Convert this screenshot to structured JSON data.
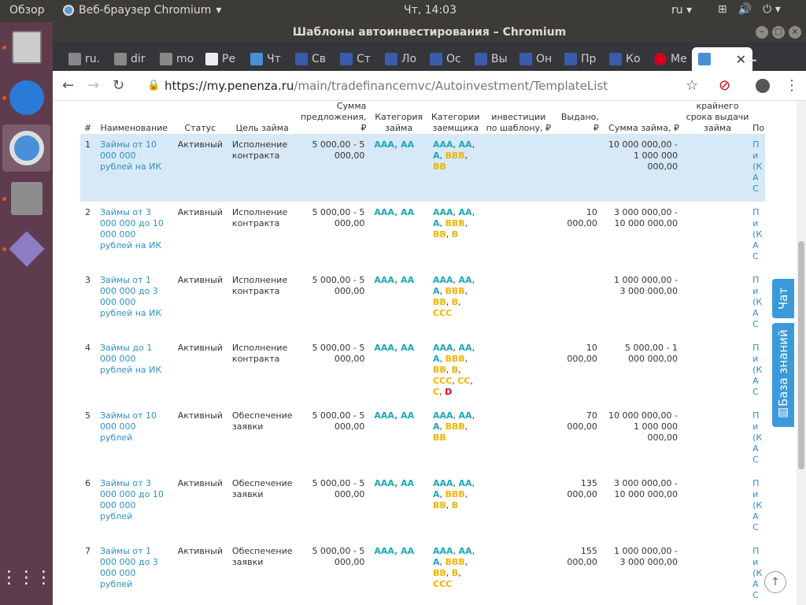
{
  "topbar": {
    "overview": "Обзор",
    "app": "Веб-браузер Chromium",
    "clock": "Чт, 14:03",
    "lang": "ru"
  },
  "window": {
    "title": "Шаблоны автоинвестирования – Chromium"
  },
  "tabs": [
    "ru.",
    "dir",
    "mo",
    "Ре",
    "Чт",
    "Св",
    "Ст",
    "Ло",
    "Ос",
    "Вы",
    "Он",
    "Пр",
    "Ко",
    "Ме"
  ],
  "toolbar": {
    "url_host": "https://my.penenza.ru",
    "url_path": "/main/tradefinancemvc/Autoinvestment/TemplateList"
  },
  "table": {
    "headers": [
      "#",
      "Наименование",
      "Статус",
      "Цель займа",
      "Сумма предложения, ₽",
      "Категория займа",
      "Категории заемщика",
      "инвестиции по шаблону, ₽",
      "Выдано, ₽",
      "Сумма займа, ₽",
      "крайнего срока выдачи займа",
      "По"
    ],
    "rows": [
      {
        "n": "1",
        "name": "Займы от 10 000 000 рублей на ИК",
        "status": "Активный",
        "goal": "Исполнение контракта",
        "sum": "5 000,00 - 5 000,00",
        "cat": "AAA, AA",
        "borrower": "AAA, AA, A, BBB, BB",
        "issued": "",
        "loan": "10 000 000,00 - 1 000 000 000,00",
        "last": "П и (К А С"
      },
      {
        "n": "2",
        "name": "Займы от 3 000 000 до 10 000 000 рублей на ИК",
        "status": "Активный",
        "goal": "Исполнение контракта",
        "sum": "5 000,00 - 5 000,00",
        "cat": "AAA, AA",
        "borrower": "AAA, AA, A, BBB, BB, B",
        "issued": "10 000,00",
        "loan": "3 000 000,00 - 10 000 000,00",
        "last": "П и (К А С"
      },
      {
        "n": "3",
        "name": "Займы от 1 000 000 до 3 000 000 рублей на ИК",
        "status": "Активный",
        "goal": "Исполнение контракта",
        "sum": "5 000,00 - 5 000,00",
        "cat": "AAA, AA",
        "borrower": "AAA, AA, A, BBB, BB, B, CCC",
        "issued": "",
        "loan": "1 000 000,00 - 3 000 000,00",
        "last": "П и (К А С"
      },
      {
        "n": "4",
        "name": "Займы до 1 000 000 рублей на ИК",
        "status": "Активный",
        "goal": "Исполнение контракта",
        "sum": "5 000,00 - 5 000,00",
        "cat": "AAA, AA",
        "borrower": "AAA, AA, A, BBB, BB, B, CCC, CC, C, D",
        "issued": "10 000,00",
        "loan": "5 000,00 - 1 000 000,00",
        "last": "П и (К А С"
      },
      {
        "n": "5",
        "name": "Займы от 10 000 000 рублей",
        "status": "Активный",
        "goal": "Обеспечение заявки",
        "sum": "5 000,00 - 5 000,00",
        "cat": "AAA, AA",
        "borrower": "AAA, AA, A, BBB, BB",
        "issued": "70 000,00",
        "loan": "10 000 000,00 - 1 000 000 000,00",
        "last": "П и (К А С"
      },
      {
        "n": "6",
        "name": "Займы от 3 000 000 до 10 000 000 рублей",
        "status": "Активный",
        "goal": "Обеспечение заявки",
        "sum": "5 000,00 - 5 000,00",
        "cat": "AAA, AA",
        "borrower": "AAA, AA, A, BBB, BB, B",
        "issued": "135 000,00",
        "loan": "3 000 000,00 - 10 000 000,00",
        "last": "П и (К А С"
      },
      {
        "n": "7",
        "name": "Займы от 1 000 000 до 3 000 000 рублей",
        "status": "Активный",
        "goal": "Обеспечение заявки",
        "sum": "5 000,00 - 5 000,00",
        "cat": "AAA, AA",
        "borrower": "AAA, AA, A, BBB, BB, B, CCC",
        "issued": "155 000,00",
        "loan": "1 000 000,00 - 3 000 000,00",
        "last": "П и (К А С"
      }
    ]
  },
  "side": {
    "chat": "Чат",
    "kb": "База знаний"
  },
  "colors": {
    "link": "#2f8fc8",
    "teal": "#19a9b7",
    "yellow": "#f0b400",
    "red": "#d0021b",
    "selected_row": "#d7e9f7"
  }
}
